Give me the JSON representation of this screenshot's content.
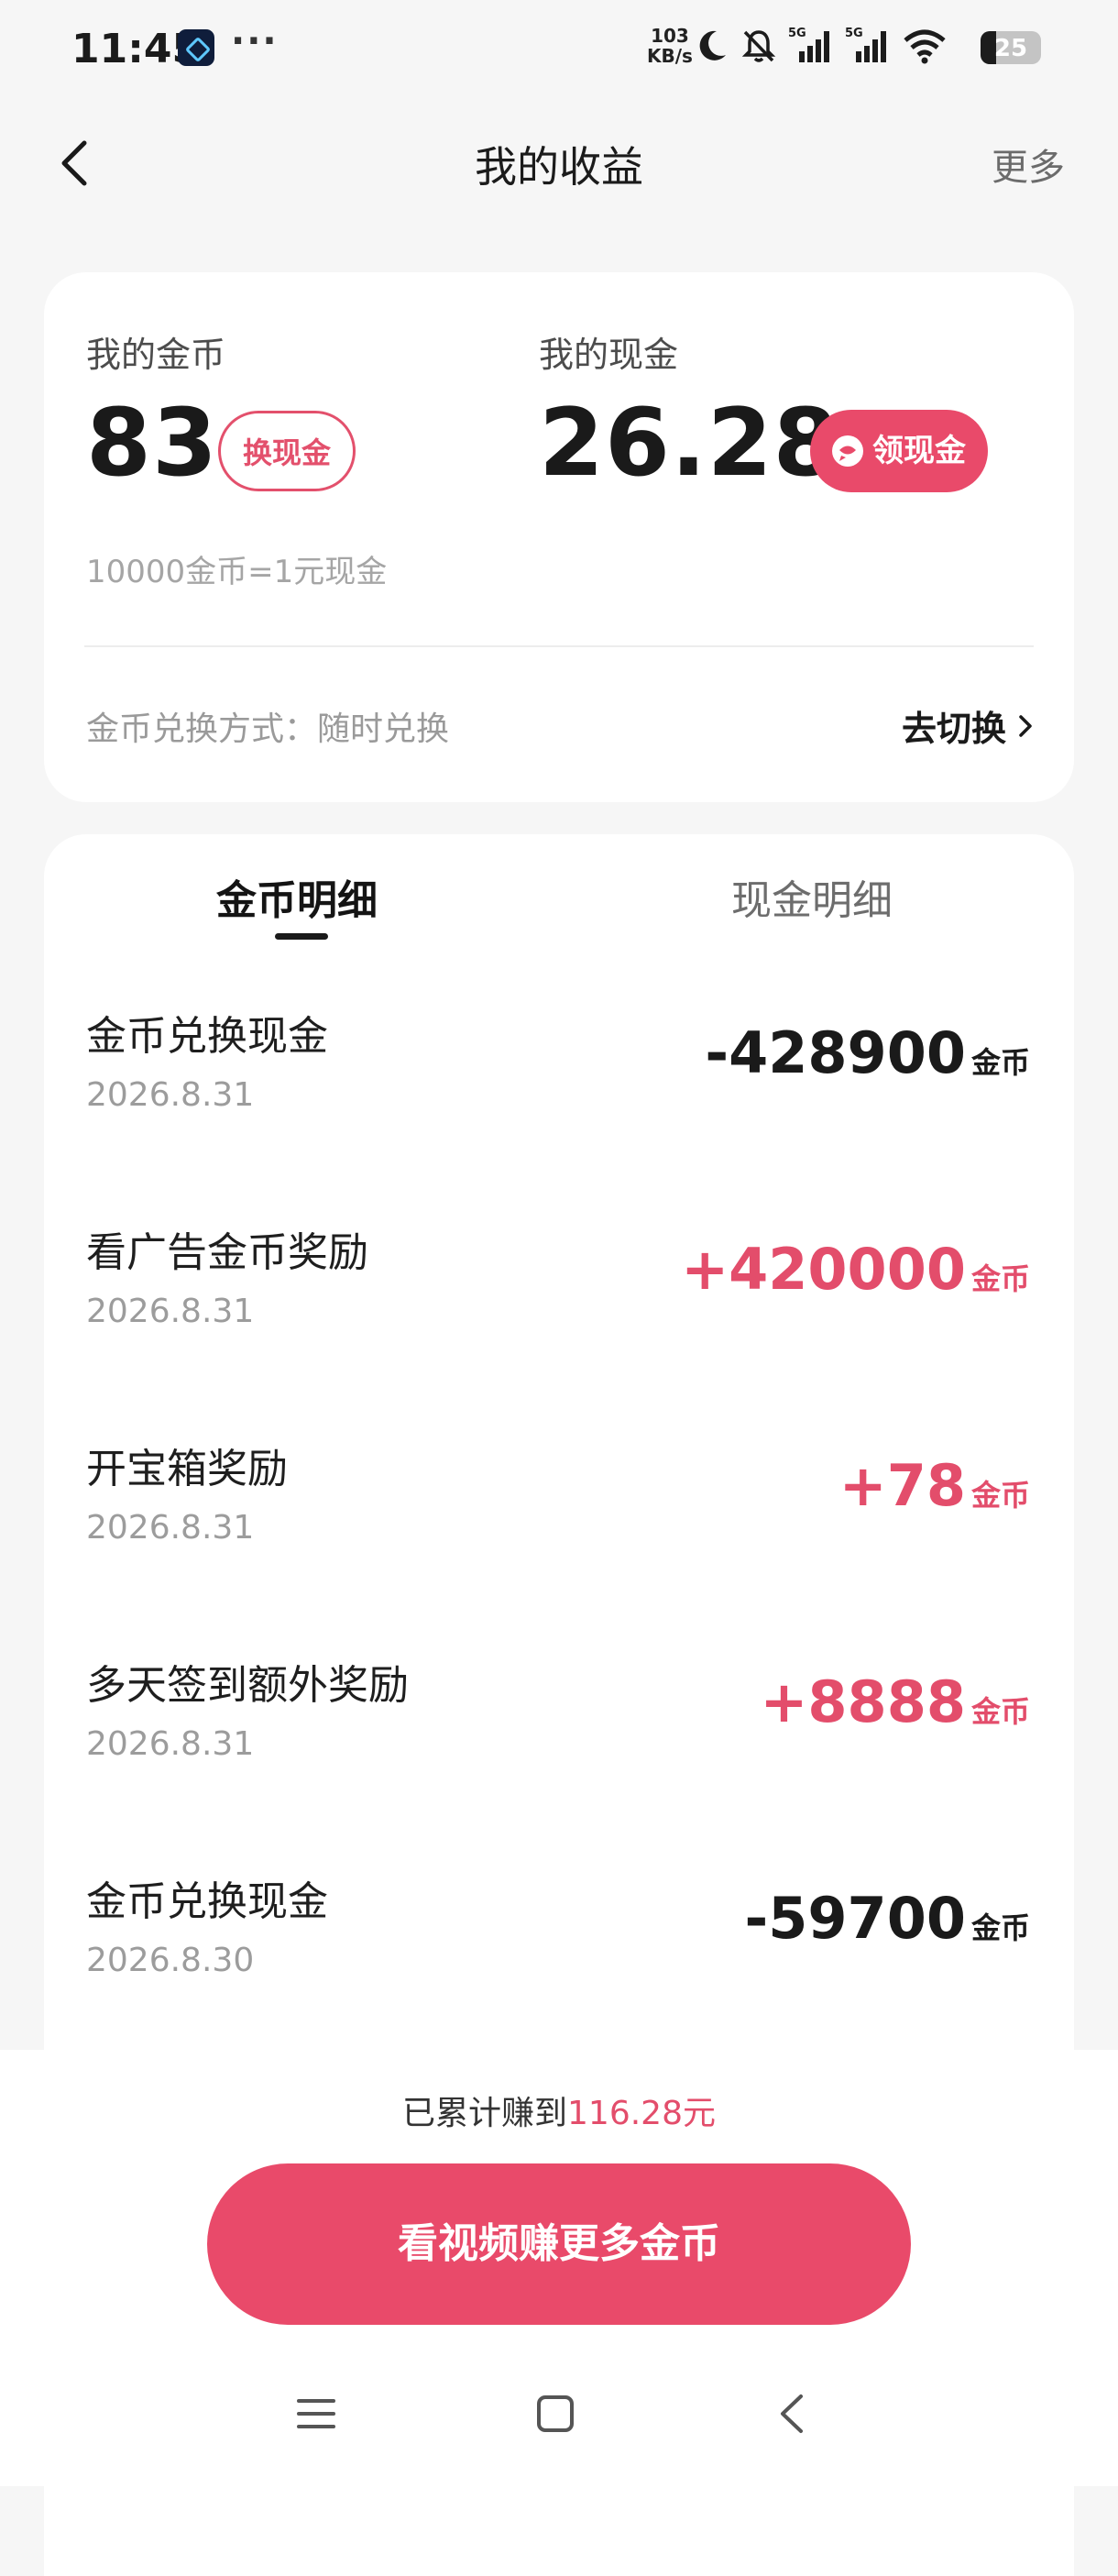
{
  "status_bar": {
    "time": "11:45",
    "dots": "···",
    "net_speed_value": "103",
    "net_speed_unit": "KB/s",
    "battery": "25",
    "battery_level": 0.25,
    "icons": [
      "app-icon",
      "moon-icon",
      "bell-mute-icon",
      "signal-5g-icon",
      "signal-5g-icon",
      "wifi-icon",
      "battery-icon"
    ]
  },
  "header": {
    "title": "我的收益",
    "more": "更多",
    "back_icon": "chevron-left-icon"
  },
  "balance": {
    "coins_label": "我的金币",
    "coins_value": "83",
    "exchange_button": "换现金",
    "cash_label": "我的现金",
    "cash_value": "26.28",
    "withdraw_button": "领现金",
    "rate": "10000金币=1元现金",
    "mode_text": "金币兑换方式：随时兑换",
    "switch_link": "去切换"
  },
  "tabs": [
    {
      "label": "金币明细",
      "active": true
    },
    {
      "label": "现金明细",
      "active": false
    }
  ],
  "records": [
    {
      "title": "金币兑换现金",
      "date": "2026.8.31",
      "amount": "-428900",
      "unit": "金币"
    },
    {
      "title": "看广告金币奖励",
      "date": "2026.8.31",
      "amount": "+420000",
      "unit": "金币"
    },
    {
      "title": "开宝箱奖励",
      "date": "2026.8.31",
      "amount": "+78",
      "unit": "金币"
    },
    {
      "title": "多天签到额外奖励",
      "date": "2026.8.31",
      "amount": "+8888",
      "unit": "金币"
    },
    {
      "title": "金币兑换现金",
      "date": "2026.8.30",
      "amount": "-59700",
      "unit": "金币"
    }
  ],
  "footer": {
    "earned_prefix": "已累计赚到",
    "earned_value": "116.28元",
    "cta": "看视频赚更多金币"
  },
  "colors": {
    "accent": "#e94a6a",
    "positive": "#e34d6b",
    "background": "#f6f6f6"
  }
}
